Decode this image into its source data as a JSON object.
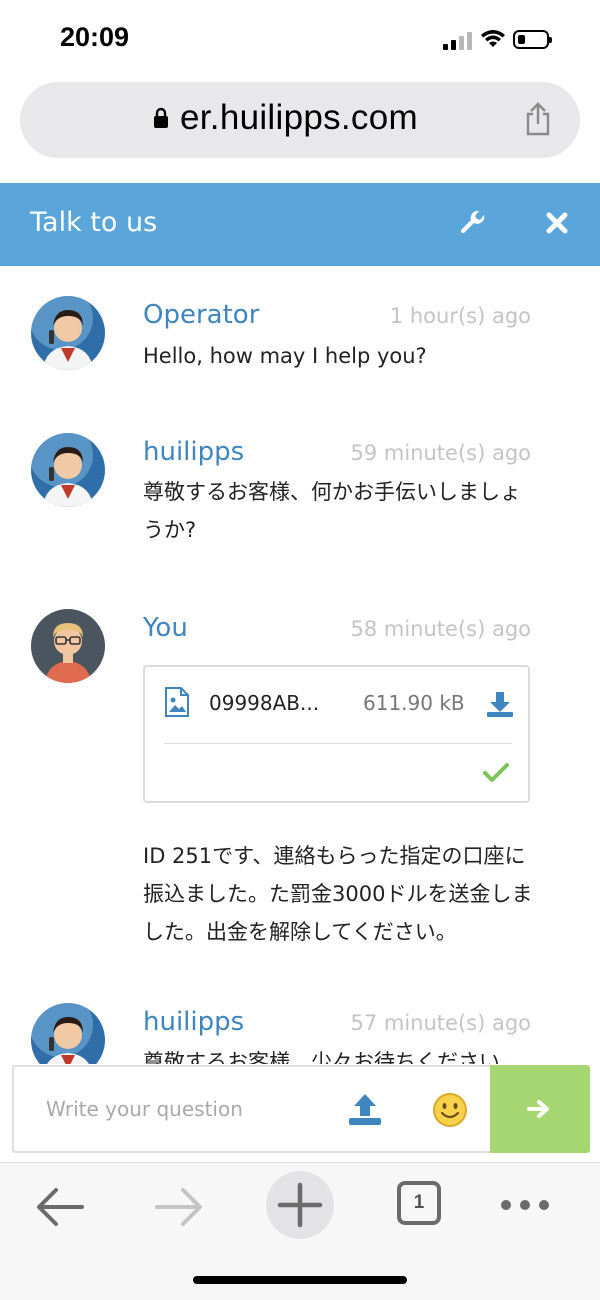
{
  "status_bar": {
    "time": "20:09"
  },
  "browser": {
    "url": "er.huilipps.com",
    "tab_count": "1"
  },
  "chat": {
    "title": "Talk to us",
    "messages": [
      {
        "sender": "Operator",
        "time": "1 hour(s) ago",
        "text": "Hello, how may I help you?",
        "avatar": "operator-photo"
      },
      {
        "sender": "huilipps",
        "time": "59 minute(s) ago",
        "text": "尊敬するお客様、何かお手伝いしましょうか?",
        "avatar": "operator-photo"
      },
      {
        "sender": "You",
        "time": "58 minute(s) ago",
        "attachment": {
          "name": "09998AB...",
          "size": "611.90 kB",
          "icon": "image-file-icon"
        },
        "text": "ID 251です、連絡もらった指定の口座に振込ました。た罰金3000ドルを送金しました。出金を解除してください。",
        "avatar": "user-avatar"
      },
      {
        "sender": "huilipps",
        "time": "57 minute(s) ago",
        "text": "尊敬するお客様、少々お待ちください。",
        "avatar": "operator-photo"
      }
    ],
    "input_placeholder": "Write your question"
  },
  "colors": {
    "header": "#5aa6db",
    "sender": "#3f86c0",
    "send_button": "#a6d672",
    "timestamp": "#c4c4c4"
  }
}
